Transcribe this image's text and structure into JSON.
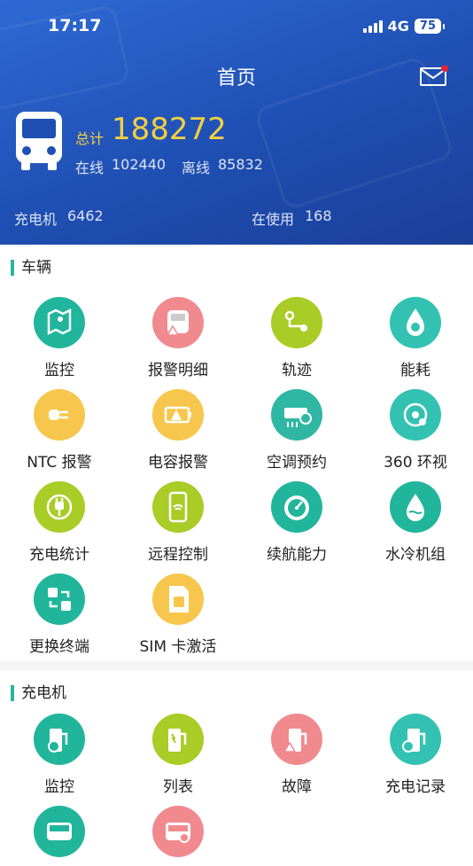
{
  "status": {
    "time": "17:17",
    "network": "4G",
    "battery": "75"
  },
  "header": {
    "title": "首页",
    "total_label": "总计",
    "total_value": "188272",
    "online_label": "在线",
    "online_value": "102440",
    "offline_label": "离线",
    "offline_value": "85832",
    "charger_label": "充电机",
    "charger_value": "6462",
    "in_use_label": "在使用",
    "in_use_value": "168"
  },
  "vehicle": {
    "title": "车辆",
    "items": [
      {
        "label": "监控",
        "icon": "map-pin-icon",
        "color": "#21b59c"
      },
      {
        "label": "报警明细",
        "icon": "bus-alert-icon",
        "color": "#f08a8f"
      },
      {
        "label": "轨迹",
        "icon": "route-icon",
        "color": "#a9cc26"
      },
      {
        "label": "能耗",
        "icon": "energy-drop-icon",
        "color": "#33c2b2"
      },
      {
        "label": "NTC 报警",
        "icon": "plug-alert-icon",
        "color": "#f7c64c"
      },
      {
        "label": "电容报警",
        "icon": "battery-alert-icon",
        "color": "#f7c64c"
      },
      {
        "label": "空调预约",
        "icon": "air-conditioner-icon",
        "color": "#2fb7a4"
      },
      {
        "label": "360 环视",
        "icon": "camera-360-icon",
        "color": "#33c2b2"
      },
      {
        "label": "充电统计",
        "icon": "charging-plug-icon",
        "color": "#a9cc26"
      },
      {
        "label": "远程控制",
        "icon": "phone-remote-icon",
        "color": "#a9cc26"
      },
      {
        "label": "续航能力",
        "icon": "gauge-icon",
        "color": "#21b59c"
      },
      {
        "label": "水冷机组",
        "icon": "water-drop-icon",
        "color": "#21b59c"
      },
      {
        "label": "更换终端",
        "icon": "swap-terminal-icon",
        "color": "#21b59c"
      },
      {
        "label": "SIM 卡激活",
        "icon": "sim-card-icon",
        "color": "#f7c64c"
      }
    ]
  },
  "charger": {
    "title": "充电机",
    "items": [
      {
        "label": "监控",
        "icon": "charger-monitor-icon",
        "color": "#21b59c"
      },
      {
        "label": "列表",
        "icon": "charger-list-icon",
        "color": "#a9cc26"
      },
      {
        "label": "故障",
        "icon": "charger-fault-icon",
        "color": "#f08a8f"
      },
      {
        "label": "充电记录",
        "icon": "charger-record-icon",
        "color": "#33c2b2"
      },
      {
        "label": "",
        "icon": "bus-icon",
        "color": "#21b59c"
      },
      {
        "label": "",
        "icon": "bus-search-icon",
        "color": "#f08a8f"
      }
    ]
  }
}
